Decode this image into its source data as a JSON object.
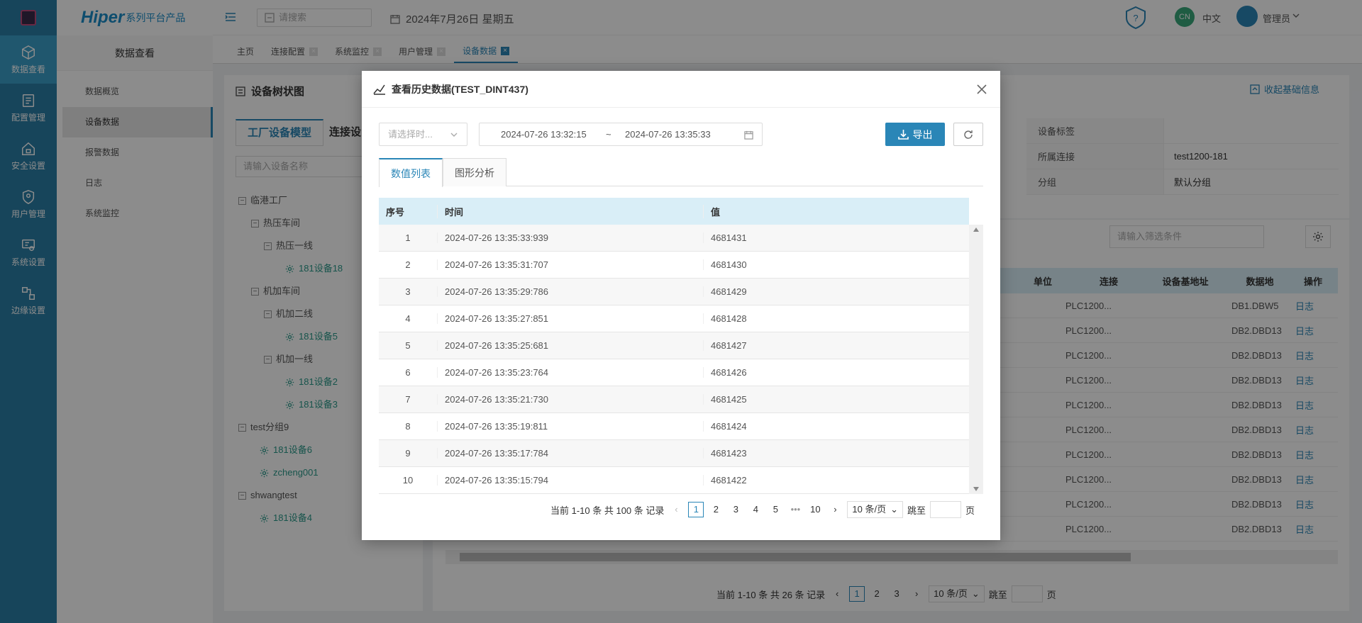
{
  "app": {
    "brand": "Hiper",
    "brand_sub": "系列平台产品"
  },
  "rail": [
    {
      "label": "数据查看",
      "icon": "cube-icon",
      "active": true
    },
    {
      "label": "配置管理",
      "icon": "config-icon",
      "active": false
    },
    {
      "label": "安全设置",
      "icon": "home-lock-icon",
      "active": false
    },
    {
      "label": "用户管理",
      "icon": "shield-user-icon",
      "active": false
    },
    {
      "label": "系统设置",
      "icon": "system-icon",
      "active": false
    },
    {
      "label": "边缘设置",
      "icon": "edge-icon",
      "active": false
    }
  ],
  "side": {
    "title": "数据查看",
    "items": [
      "数据概览",
      "设备数据",
      "报警数据",
      "日志",
      "系统监控"
    ]
  },
  "topbar": {
    "search_placeholder": "请搜索",
    "date": "2024年7月26日 星期五",
    "lang_badge": "CN",
    "lang": "中文",
    "user": "管理员"
  },
  "tabs": [
    "主页",
    "连接配置",
    "系统监控",
    "用户管理",
    "设备数据"
  ],
  "bg": {
    "tree_title": "设备树状图",
    "tree_tab1": "工厂设备模型",
    "tree_tab2": "连接设",
    "tree_search": "请输入设备名称",
    "collapse": "收起基础信息",
    "filter_placeholder": "请输入筛选条件",
    "tree": [
      {
        "label": "临港工厂",
        "level": 0,
        "type": "group"
      },
      {
        "label": "热压车间",
        "level": 1,
        "type": "group"
      },
      {
        "label": "热压一线",
        "level": 2,
        "type": "group"
      },
      {
        "label": "181设备18",
        "level": 3,
        "type": "device"
      },
      {
        "label": "机加车间",
        "level": 1,
        "type": "group"
      },
      {
        "label": "机加二线",
        "level": 2,
        "type": "group"
      },
      {
        "label": "181设备5",
        "level": 3,
        "type": "device"
      },
      {
        "label": "机加一线",
        "level": 2,
        "type": "group"
      },
      {
        "label": "181设备2",
        "level": 3,
        "type": "device"
      },
      {
        "label": "181设备3",
        "level": 3,
        "type": "device"
      },
      {
        "label": "test分组9",
        "level": 0,
        "type": "group"
      },
      {
        "label": "181设备6",
        "level": 1,
        "type": "device"
      },
      {
        "label": "zcheng001",
        "level": 1,
        "type": "device"
      },
      {
        "label": "shwangtest",
        "level": 0,
        "type": "group"
      },
      {
        "label": "181设备4",
        "level": 1,
        "type": "device"
      }
    ],
    "info": [
      {
        "k": "设备标签",
        "v": ""
      },
      {
        "k": "所属连接",
        "v": "test1200-181"
      },
      {
        "k": "分组",
        "v": "默认分组"
      }
    ],
    "headers": [
      "单位",
      "连接",
      "设备基地址",
      "数据地",
      "操作"
    ],
    "rows": [
      [
        "PLC1200...",
        "DB1.DBW5",
        "日志"
      ],
      [
        "PLC1200...",
        "DB2.DBD13",
        "日志"
      ],
      [
        "PLC1200...",
        "DB2.DBD13",
        "日志"
      ],
      [
        "PLC1200...",
        "DB2.DBD13",
        "日志"
      ],
      [
        "PLC1200...",
        "DB2.DBD13",
        "日志"
      ],
      [
        "PLC1200...",
        "DB2.DBD13",
        "日志"
      ],
      [
        "PLC1200...",
        "DB2.DBD13",
        "日志"
      ],
      [
        "PLC1200...",
        "DB2.DBD13",
        "日志"
      ],
      [
        "PLC1200...",
        "DB2.DBD13",
        "日志"
      ],
      [
        "PLC1200...",
        "DB2.DBD13",
        "日志"
      ]
    ],
    "pager": {
      "summary": "当前 1-10 条 共 26 条 记录",
      "pages": [
        "1",
        "2",
        "3"
      ],
      "size": "10 条/页",
      "jump": "跳至",
      "unit": "页"
    }
  },
  "modal": {
    "title": "查看历史数据(TEST_DINT437)",
    "time_select_placeholder": "请选择时...",
    "start": "2024-07-26 13:32:15",
    "sep": "~",
    "end": "2024-07-26 13:35:33",
    "export": "导出",
    "tabs": [
      "数值列表",
      "图形分析"
    ],
    "columns": [
      "序号",
      "时间",
      "值"
    ],
    "rows": [
      [
        "1",
        "2024-07-26 13:35:33:939",
        "4681431"
      ],
      [
        "2",
        "2024-07-26 13:35:31:707",
        "4681430"
      ],
      [
        "3",
        "2024-07-26 13:35:29:786",
        "4681429"
      ],
      [
        "4",
        "2024-07-26 13:35:27:851",
        "4681428"
      ],
      [
        "5",
        "2024-07-26 13:35:25:681",
        "4681427"
      ],
      [
        "6",
        "2024-07-26 13:35:23:764",
        "4681426"
      ],
      [
        "7",
        "2024-07-26 13:35:21:730",
        "4681425"
      ],
      [
        "8",
        "2024-07-26 13:35:19:811",
        "4681424"
      ],
      [
        "9",
        "2024-07-26 13:35:17:784",
        "4681423"
      ],
      [
        "10",
        "2024-07-26 13:35:15:794",
        "4681422"
      ]
    ],
    "pager": {
      "summary": "当前 1-10 条 共 100 条 记录",
      "pages": [
        "1",
        "2",
        "3",
        "4",
        "5",
        "•••",
        "10"
      ],
      "size": "10 条/页",
      "jump": "跳至",
      "unit": "页"
    }
  },
  "colors": {
    "accent": "#2a86b7",
    "rail": "#2a7ea6",
    "header_row": "#d9eef7"
  }
}
